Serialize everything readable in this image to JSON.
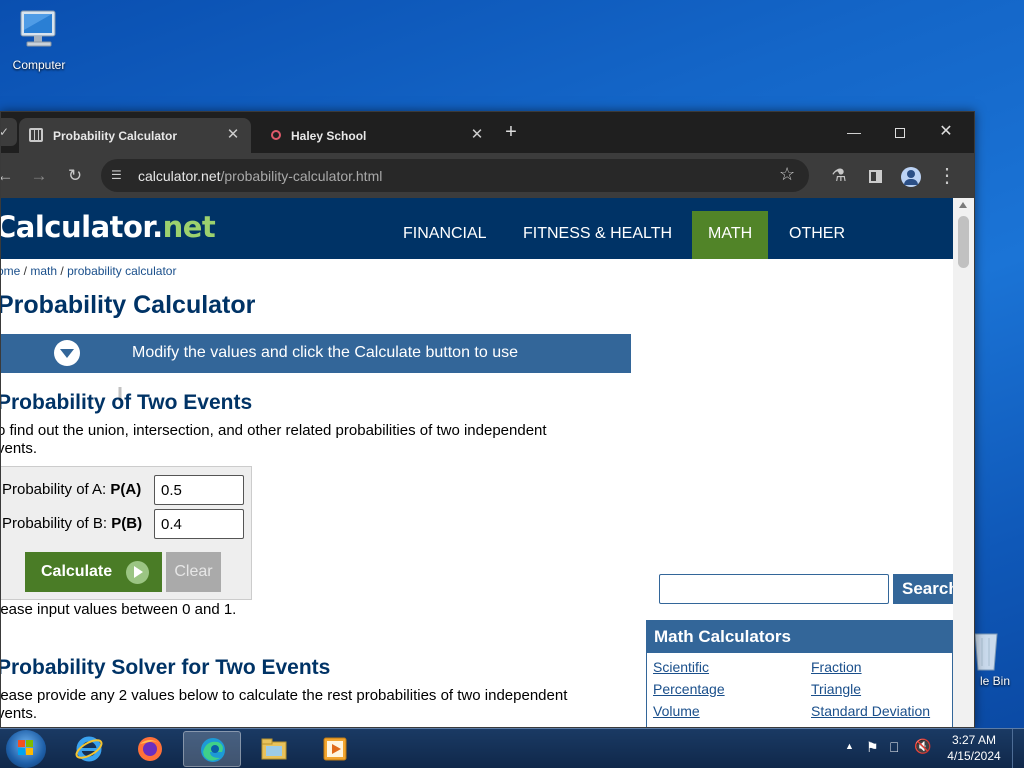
{
  "desktop": {
    "computer_label": "Computer",
    "recycle_label": "le Bin"
  },
  "browser": {
    "tabs": [
      {
        "label": "Probability Calculator",
        "active": true
      },
      {
        "label": "Haley School",
        "active": false
      }
    ],
    "url_host": "calculator.net",
    "url_path": "/probability-calculator.html"
  },
  "site": {
    "logo_main": "Calculator.",
    "logo_net": "net",
    "nav": [
      "FINANCIAL",
      "FITNESS & HEALTH",
      "MATH",
      "OTHER"
    ],
    "nav_active": "MATH",
    "breadcrumb": [
      "ome",
      "math",
      "probability calculator"
    ],
    "page_title": "Probability Calculator",
    "banner_text": "Modify the values and click the Calculate button to use"
  },
  "section1": {
    "title": "Probability of Two Events",
    "desc_line1": "o find out the union, intersection, and other related probabilities of two independent",
    "desc_line2": "vents.",
    "label_a": "Probability of A:",
    "label_a_bold": "P(A)",
    "value_a": "0.5",
    "label_b": "Probability of B:",
    "label_b_bold": "P(B)",
    "value_b": "0.4",
    "calculate": "Calculate",
    "clear": "Clear",
    "hint": "lease input values between 0 and 1."
  },
  "section2": {
    "title": "Probability Solver for Two Events",
    "desc_line1": "lease provide any 2 values below to calculate the rest probabilities of two independent",
    "desc_line2": "vents."
  },
  "sidebar": {
    "search_button": "Search",
    "panel_title": "Math Calculators",
    "links_left": [
      "Scientific",
      "Percentage",
      "Volume"
    ],
    "links_right": [
      "Fraction",
      "Triangle",
      "Standard Deviation"
    ]
  },
  "taskbar": {
    "time": "3:27 AM",
    "date": "4/15/2024"
  }
}
